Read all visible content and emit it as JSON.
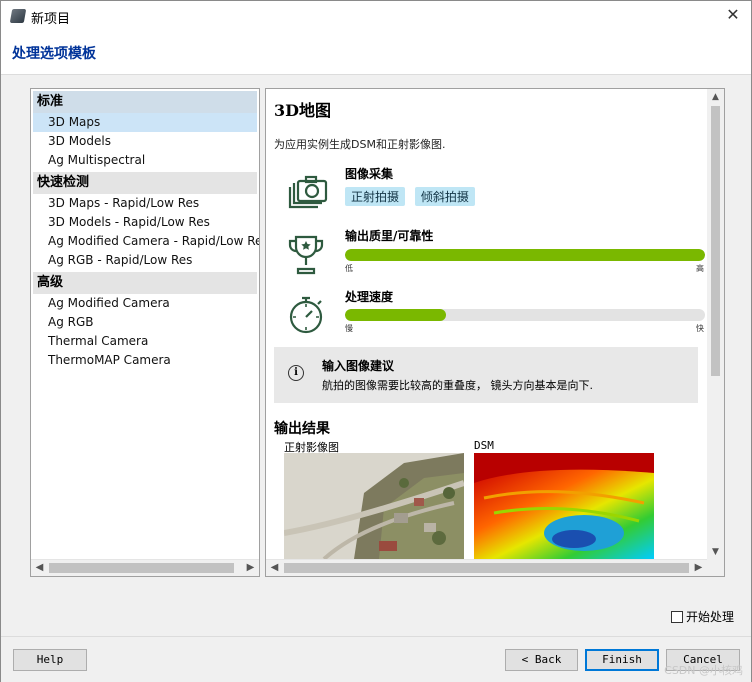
{
  "window": {
    "title": "新项目",
    "close_glyph": "✕"
  },
  "page_title": "处理选项模板",
  "groups": [
    {
      "label": "标准",
      "items": [
        "3D Maps",
        "3D Models",
        "Ag Multispectral"
      ]
    },
    {
      "label": "快速检测",
      "items": [
        "3D Maps - Rapid/Low Res",
        "3D Models - Rapid/Low Res",
        "Ag Modified Camera - Rapid/Low Res",
        "Ag RGB - Rapid/Low Res"
      ]
    },
    {
      "label": "高级",
      "items": [
        "Ag Modified Camera",
        "Ag RGB",
        "Thermal Camera",
        "ThermoMAP Camera"
      ]
    }
  ],
  "selected_item": "3D Maps",
  "detail": {
    "title": "3D地图",
    "description": "为应用实例生成DSM和正射影像图.",
    "capture": {
      "label": "图像采集",
      "tags": [
        "正射拍摄",
        "倾斜拍摄"
      ]
    },
    "quality": {
      "label": "输出质里/可靠性",
      "low": "低",
      "high": "高",
      "value": 1.0
    },
    "speed": {
      "label": "处理速度",
      "low": "慢",
      "high": "快",
      "value": 0.28
    },
    "tip": {
      "icon": "i",
      "title": "输入图像建议",
      "text": "航拍的图像需要比较高的重叠度， 镜头方向基本是向下."
    },
    "outputs": {
      "title": "输出结果",
      "items": [
        "正射影像图",
        "DSM"
      ]
    }
  },
  "icons": {
    "capture": "camera-stack-icon",
    "quality": "trophy-icon",
    "speed": "stopwatch-icon",
    "tip": "info-icon"
  },
  "scroll_arrows": {
    "left": "◀",
    "right": "▶",
    "up": "▲",
    "down": "▼"
  },
  "start_processing": {
    "label": "开始处理",
    "checked": false
  },
  "buttons": {
    "help": "Help",
    "back": "< Back",
    "finish": "Finish",
    "cancel": "Cancel"
  },
  "watermark": "CSDN @小核鸡",
  "colors": {
    "title_blue": "#003399",
    "bar_green": "#7ab800",
    "tag_blue": "#bfe6f5",
    "selection": "#cce4f7"
  }
}
